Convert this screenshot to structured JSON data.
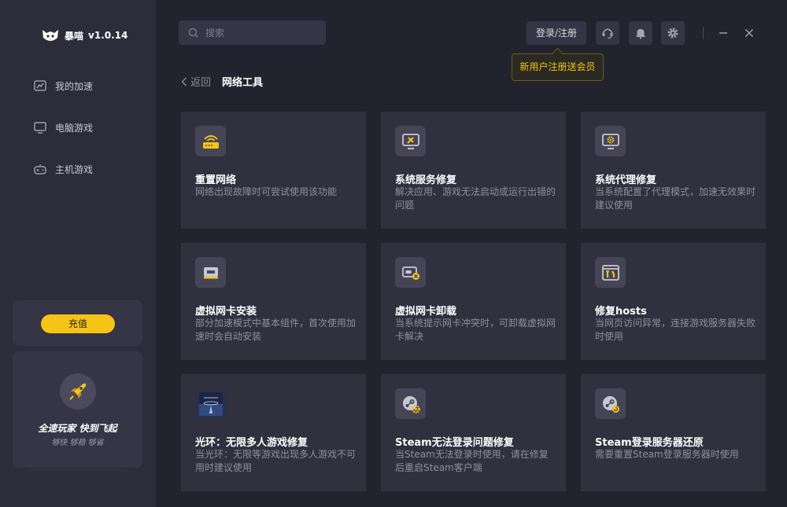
{
  "brand": {
    "name": "暴喵",
    "version": "v1.0.14"
  },
  "nav": [
    {
      "label": "我的加速",
      "icon": "chart-icon"
    },
    {
      "label": "电脑游戏",
      "icon": "monitor-icon"
    },
    {
      "label": "主机游戏",
      "icon": "gamepad-icon"
    }
  ],
  "recharge": {
    "label": "充值"
  },
  "promo": {
    "title": "全速玩家  快到飞起",
    "subtitle": "够快  够稳  够省"
  },
  "search": {
    "placeholder": "搜索"
  },
  "header": {
    "login_label": "登录/注册",
    "tooltip": "新用户注册送会员"
  },
  "breadcrumb": {
    "back_label": "返回",
    "title": "网络工具"
  },
  "accent": "#f6c417",
  "cards": [
    {
      "title": "重置网络",
      "desc": "网络出现故障时可尝试使用该功能",
      "icon": "router-icon"
    },
    {
      "title": "系统服务修复",
      "desc": "解决应用、游戏无法启动或运行出错的问题",
      "icon": "monitor-tools-icon"
    },
    {
      "title": "系统代理修复",
      "desc": "当系统配置了代理模式，加速无效果时建议使用",
      "icon": "monitor-gear-icon"
    },
    {
      "title": "虚拟网卡安装",
      "desc": "部分加速模式中基本组件，首次使用加速时会自动安装",
      "icon": "network-card-icon"
    },
    {
      "title": "虚拟网卡卸载",
      "desc": "当系统提示网卡冲突时，可卸载虚拟网卡解决",
      "icon": "network-card-remove-icon"
    },
    {
      "title": "修复hosts",
      "desc": "当网页访问异常，连接游戏服务器失败时使用",
      "icon": "hosts-tools-icon"
    },
    {
      "title": "光环：无限多人游戏修复",
      "desc": "当光环：无限等游戏出现多人游戏不可用时建议使用",
      "icon": "halo-game-icon"
    },
    {
      "title": "Steam无法登录问题修复",
      "desc": "当Steam无法登录时使用，请在修复后重启Steam客户端",
      "icon": "steam-gear-icon"
    },
    {
      "title": "Steam登录服务器还原",
      "desc": "需要重置Steam登录服务器时使用",
      "icon": "steam-restore-icon"
    }
  ]
}
